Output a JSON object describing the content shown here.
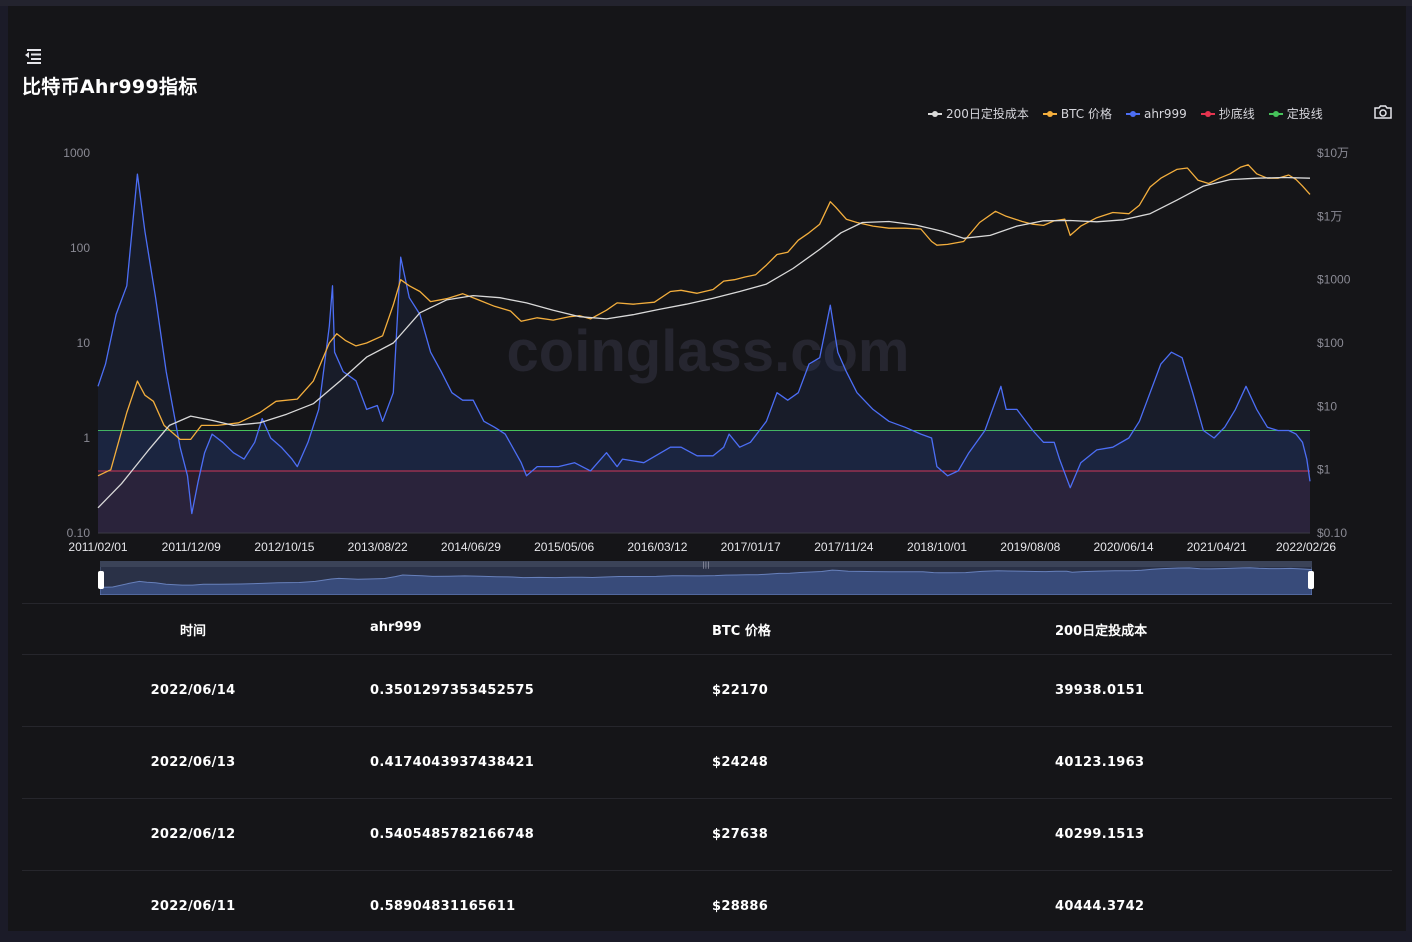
{
  "page": {
    "title": "比特币Ahr999指标",
    "watermark": "coinglass.com"
  },
  "legend": [
    {
      "label": "200日定投成本",
      "color": "#d9d9d9",
      "icon": "line-dot"
    },
    {
      "label": "BTC 价格",
      "color": "#f3ae3d",
      "icon": "line-dot"
    },
    {
      "label": "ahr999",
      "color": "#4c6ef5",
      "icon": "line-dot"
    },
    {
      "label": "抄底线",
      "color": "#e5344f",
      "icon": "line-dot"
    },
    {
      "label": "定投线",
      "color": "#46c25a",
      "icon": "line-dot"
    }
  ],
  "chart_data": {
    "type": "line",
    "x_ticks": [
      "2011/02/01",
      "2011/12/09",
      "2012/10/15",
      "2013/08/22",
      "2014/06/29",
      "2015/05/06",
      "2016/03/12",
      "2017/01/17",
      "2017/11/24",
      "2018/10/01",
      "2019/08/08",
      "2020/06/14",
      "2021/04/21",
      "2022/02/26"
    ],
    "y_left": {
      "scale": "log",
      "ticks": [
        "1000",
        "100",
        "10",
        "1",
        "0.10"
      ],
      "range": [
        0.1,
        1000
      ]
    },
    "y_right": {
      "scale": "log",
      "ticks": [
        "$10万",
        "$1万",
        "$1000",
        "$100",
        "$10",
        "$1",
        "$0.10"
      ],
      "range": [
        0.1,
        100000
      ]
    },
    "reference_lines": [
      {
        "name": "定投线",
        "value": 1.2,
        "color": "#46c25a"
      },
      {
        "name": "抄底线",
        "value": 0.45,
        "color": "#e5344f"
      }
    ],
    "series": [
      {
        "name": "ahr999",
        "axis": "left",
        "color": "#4c6ef5",
        "points": [
          [
            2011.08,
            3.5
          ],
          [
            2011.15,
            6
          ],
          [
            2011.25,
            20
          ],
          [
            2011.35,
            40
          ],
          [
            2011.45,
            600
          ],
          [
            2011.52,
            150
          ],
          [
            2011.62,
            30
          ],
          [
            2011.72,
            5
          ],
          [
            2011.85,
            0.8
          ],
          [
            2011.92,
            0.4
          ],
          [
            2011.96,
            0.16
          ],
          [
            2012.02,
            0.35
          ],
          [
            2012.08,
            0.7
          ],
          [
            2012.15,
            1.1
          ],
          [
            2012.25,
            0.9
          ],
          [
            2012.35,
            0.7
          ],
          [
            2012.45,
            0.6
          ],
          [
            2012.55,
            0.9
          ],
          [
            2012.62,
            1.6
          ],
          [
            2012.7,
            1
          ],
          [
            2012.8,
            0.8
          ],
          [
            2012.9,
            0.6
          ],
          [
            2012.95,
            0.5
          ],
          [
            2013.05,
            0.9
          ],
          [
            2013.15,
            2
          ],
          [
            2013.25,
            15
          ],
          [
            2013.28,
            40
          ],
          [
            2013.3,
            8
          ],
          [
            2013.38,
            5
          ],
          [
            2013.5,
            4
          ],
          [
            2013.6,
            2
          ],
          [
            2013.7,
            2.2
          ],
          [
            2013.75,
            1.5
          ],
          [
            2013.85,
            3
          ],
          [
            2013.92,
            80
          ],
          [
            2014.0,
            30
          ],
          [
            2014.1,
            20
          ],
          [
            2014.2,
            8
          ],
          [
            2014.3,
            5
          ],
          [
            2014.4,
            3
          ],
          [
            2014.5,
            2.5
          ],
          [
            2014.6,
            2.5
          ],
          [
            2014.7,
            1.5
          ],
          [
            2014.8,
            1.3
          ],
          [
            2014.9,
            1.1
          ],
          [
            2015.05,
            0.55
          ],
          [
            2015.1,
            0.4
          ],
          [
            2015.2,
            0.5
          ],
          [
            2015.4,
            0.5
          ],
          [
            2015.55,
            0.55
          ],
          [
            2015.7,
            0.45
          ],
          [
            2015.85,
            0.7
          ],
          [
            2015.95,
            0.5
          ],
          [
            2016.0,
            0.6
          ],
          [
            2016.2,
            0.55
          ],
          [
            2016.45,
            0.8
          ],
          [
            2016.55,
            0.8
          ],
          [
            2016.7,
            0.65
          ],
          [
            2016.85,
            0.65
          ],
          [
            2016.95,
            0.8
          ],
          [
            2017.0,
            1.1
          ],
          [
            2017.1,
            0.8
          ],
          [
            2017.2,
            0.9
          ],
          [
            2017.35,
            1.5
          ],
          [
            2017.45,
            3
          ],
          [
            2017.55,
            2.5
          ],
          [
            2017.65,
            3
          ],
          [
            2017.75,
            6
          ],
          [
            2017.85,
            7
          ],
          [
            2017.95,
            25
          ],
          [
            2018.02,
            8
          ],
          [
            2018.1,
            5
          ],
          [
            2018.2,
            3
          ],
          [
            2018.35,
            2
          ],
          [
            2018.5,
            1.5
          ],
          [
            2018.65,
            1.3
          ],
          [
            2018.8,
            1.1
          ],
          [
            2018.9,
            1.0
          ],
          [
            2018.95,
            0.5
          ],
          [
            2019.05,
            0.4
          ],
          [
            2019.15,
            0.45
          ],
          [
            2019.25,
            0.7
          ],
          [
            2019.4,
            1.2
          ],
          [
            2019.55,
            3.5
          ],
          [
            2019.6,
            2
          ],
          [
            2019.7,
            2
          ],
          [
            2019.85,
            1.2
          ],
          [
            2019.95,
            0.9
          ],
          [
            2020.05,
            0.9
          ],
          [
            2020.1,
            0.6
          ],
          [
            2020.2,
            0.3
          ],
          [
            2020.3,
            0.55
          ],
          [
            2020.45,
            0.75
          ],
          [
            2020.6,
            0.8
          ],
          [
            2020.75,
            1
          ],
          [
            2020.85,
            1.5
          ],
          [
            2020.95,
            3
          ],
          [
            2021.05,
            6
          ],
          [
            2021.15,
            8
          ],
          [
            2021.25,
            7
          ],
          [
            2021.35,
            3
          ],
          [
            2021.45,
            1.2
          ],
          [
            2021.55,
            1
          ],
          [
            2021.65,
            1.3
          ],
          [
            2021.75,
            2
          ],
          [
            2021.85,
            3.5
          ],
          [
            2021.95,
            2
          ],
          [
            2022.05,
            1.3
          ],
          [
            2022.15,
            1.2
          ],
          [
            2022.25,
            1.2
          ],
          [
            2022.32,
            1.1
          ],
          [
            2022.38,
            0.9
          ],
          [
            2022.42,
            0.6
          ],
          [
            2022.45,
            0.35
          ]
        ]
      },
      {
        "name": "BTC 价格",
        "axis": "right",
        "color": "#f3ae3d",
        "points": [
          [
            2011.08,
            0.8
          ],
          [
            2011.2,
            1
          ],
          [
            2011.35,
            8
          ],
          [
            2011.45,
            25
          ],
          [
            2011.52,
            15
          ],
          [
            2011.6,
            12
          ],
          [
            2011.7,
            5
          ],
          [
            2011.85,
            3
          ],
          [
            2011.95,
            3
          ],
          [
            2012.05,
            5
          ],
          [
            2012.2,
            5
          ],
          [
            2012.4,
            5.5
          ],
          [
            2012.6,
            8
          ],
          [
            2012.75,
            12
          ],
          [
            2012.95,
            13
          ],
          [
            2013.1,
            25
          ],
          [
            2013.25,
            100
          ],
          [
            2013.32,
            140
          ],
          [
            2013.4,
            110
          ],
          [
            2013.5,
            90
          ],
          [
            2013.6,
            100
          ],
          [
            2013.75,
            130
          ],
          [
            2013.85,
            400
          ],
          [
            2013.92,
            1000
          ],
          [
            2014.0,
            800
          ],
          [
            2014.1,
            650
          ],
          [
            2014.2,
            450
          ],
          [
            2014.35,
            500
          ],
          [
            2014.5,
            600
          ],
          [
            2014.65,
            480
          ],
          [
            2014.8,
            380
          ],
          [
            2014.95,
            320
          ],
          [
            2015.05,
            220
          ],
          [
            2015.2,
            250
          ],
          [
            2015.35,
            230
          ],
          [
            2015.5,
            260
          ],
          [
            2015.6,
            270
          ],
          [
            2015.7,
            240
          ],
          [
            2015.85,
            330
          ],
          [
            2015.95,
            430
          ],
          [
            2016.1,
            410
          ],
          [
            2016.3,
            440
          ],
          [
            2016.45,
            650
          ],
          [
            2016.55,
            680
          ],
          [
            2016.7,
            610
          ],
          [
            2016.85,
            700
          ],
          [
            2016.95,
            950
          ],
          [
            2017.05,
            1000
          ],
          [
            2017.15,
            1100
          ],
          [
            2017.25,
            1200
          ],
          [
            2017.35,
            1700
          ],
          [
            2017.45,
            2500
          ],
          [
            2017.55,
            2700
          ],
          [
            2017.65,
            4200
          ],
          [
            2017.75,
            5500
          ],
          [
            2017.85,
            7500
          ],
          [
            2017.95,
            17000
          ],
          [
            2018.0,
            14000
          ],
          [
            2018.1,
            9000
          ],
          [
            2018.2,
            8000
          ],
          [
            2018.35,
            7000
          ],
          [
            2018.5,
            6500
          ],
          [
            2018.65,
            6500
          ],
          [
            2018.8,
            6300
          ],
          [
            2018.9,
            4000
          ],
          [
            2018.95,
            3500
          ],
          [
            2019.05,
            3600
          ],
          [
            2019.2,
            4000
          ],
          [
            2019.35,
            8000
          ],
          [
            2019.5,
            12000
          ],
          [
            2019.6,
            10000
          ],
          [
            2019.75,
            8300
          ],
          [
            2019.85,
            7500
          ],
          [
            2019.95,
            7200
          ],
          [
            2020.05,
            8500
          ],
          [
            2020.15,
            9000
          ],
          [
            2020.2,
            5000
          ],
          [
            2020.3,
            7000
          ],
          [
            2020.45,
            9500
          ],
          [
            2020.6,
            11500
          ],
          [
            2020.75,
            11000
          ],
          [
            2020.85,
            15000
          ],
          [
            2020.95,
            29000
          ],
          [
            2021.05,
            40000
          ],
          [
            2021.2,
            55000
          ],
          [
            2021.3,
            58000
          ],
          [
            2021.4,
            37000
          ],
          [
            2021.5,
            33000
          ],
          [
            2021.6,
            40000
          ],
          [
            2021.7,
            47000
          ],
          [
            2021.8,
            60000
          ],
          [
            2021.87,
            65000
          ],
          [
            2021.95,
            47000
          ],
          [
            2022.05,
            40000
          ],
          [
            2022.15,
            40000
          ],
          [
            2022.25,
            45000
          ],
          [
            2022.32,
            38000
          ],
          [
            2022.38,
            30000
          ],
          [
            2022.45,
            22170
          ]
        ]
      },
      {
        "name": "200日定投成本",
        "axis": "right",
        "color": "#d9d9d9",
        "points": [
          [
            2011.08,
            0.25
          ],
          [
            2011.3,
            0.6
          ],
          [
            2011.55,
            2
          ],
          [
            2011.75,
            5
          ],
          [
            2011.95,
            7
          ],
          [
            2012.15,
            6
          ],
          [
            2012.35,
            5
          ],
          [
            2012.6,
            5.5
          ],
          [
            2012.85,
            7.5
          ],
          [
            2013.1,
            11
          ],
          [
            2013.35,
            25
          ],
          [
            2013.6,
            60
          ],
          [
            2013.85,
            100
          ],
          [
            2014.1,
            300
          ],
          [
            2014.35,
            480
          ],
          [
            2014.6,
            560
          ],
          [
            2014.85,
            520
          ],
          [
            2015.1,
            430
          ],
          [
            2015.35,
            330
          ],
          [
            2015.6,
            260
          ],
          [
            2015.85,
            240
          ],
          [
            2016.1,
            280
          ],
          [
            2016.35,
            340
          ],
          [
            2016.6,
            410
          ],
          [
            2016.85,
            510
          ],
          [
            2017.1,
            650
          ],
          [
            2017.35,
            850
          ],
          [
            2017.6,
            1500
          ],
          [
            2017.85,
            3000
          ],
          [
            2018.05,
            5500
          ],
          [
            2018.25,
            8000
          ],
          [
            2018.5,
            8300
          ],
          [
            2018.75,
            7300
          ],
          [
            2019.0,
            5800
          ],
          [
            2019.2,
            4500
          ],
          [
            2019.45,
            5000
          ],
          [
            2019.7,
            7000
          ],
          [
            2019.95,
            8500
          ],
          [
            2020.2,
            8600
          ],
          [
            2020.45,
            8200
          ],
          [
            2020.7,
            8800
          ],
          [
            2020.95,
            11000
          ],
          [
            2021.2,
            18000
          ],
          [
            2021.45,
            30000
          ],
          [
            2021.7,
            38000
          ],
          [
            2021.95,
            40000
          ],
          [
            2022.2,
            41000
          ],
          [
            2022.45,
            39938
          ]
        ]
      }
    ]
  },
  "table": {
    "headers": [
      "时间",
      "ahr999",
      "BTC 价格",
      "200日定投成本"
    ],
    "rows": [
      [
        "2022/06/14",
        "0.3501297353452575",
        "$22170",
        "39938.0151"
      ],
      [
        "2022/06/13",
        "0.4174043937438421",
        "$24248",
        "40123.1963"
      ],
      [
        "2022/06/12",
        "0.5405485782166748",
        "$27638",
        "40299.1513"
      ],
      [
        "2022/06/11",
        "0.58904831165611",
        "$28886",
        "40444.3742"
      ]
    ]
  }
}
